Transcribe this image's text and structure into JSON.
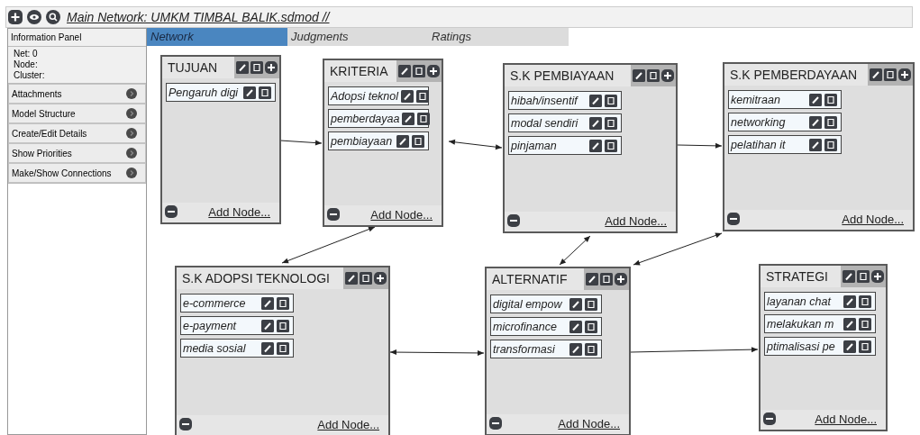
{
  "window": {
    "title": "Main Network: UMKM TIMBAL BALIK.sdmod //"
  },
  "tabs": [
    {
      "label": "Network",
      "selected": true
    },
    {
      "label": "Judgments",
      "selected": false
    },
    {
      "label": "Ratings",
      "selected": false
    }
  ],
  "info_panel": {
    "title": "Information Panel",
    "lines": [
      "Net: 0",
      "Node:",
      "Cluster:"
    ],
    "sections": [
      "Attachments",
      "Model Structure",
      "Create/Edit Details",
      "Show Priorities",
      "Make/Show Connections"
    ]
  },
  "clusters": [
    {
      "title": "TUJUAN",
      "nodes": [
        "Pengaruh digi"
      ],
      "add_label": "Add Node..."
    },
    {
      "title": "KRITERIA",
      "nodes": [
        "Adopsi teknol",
        "pemberdayaa",
        "pembiayaan"
      ],
      "add_label": "Add Node..."
    },
    {
      "title": "S.K PEMBIAYAAN",
      "nodes": [
        "hibah/insentif",
        "modal sendiri",
        "pinjaman"
      ],
      "add_label": "Add Node..."
    },
    {
      "title": "S.K PEMBERDAYAAN",
      "nodes": [
        "kemitraan",
        "networking",
        "pelatihan it"
      ],
      "add_label": "Add Node..."
    },
    {
      "title": "S.K ADOPSI TEKNOLOGI",
      "nodes": [
        "e-commerce",
        "e-payment",
        "media sosial"
      ],
      "add_label": "Add Node..."
    },
    {
      "title": "ALTERNATIF",
      "nodes": [
        "digital empow",
        "microfinance",
        "transformasi"
      ],
      "add_label": "Add Node..."
    },
    {
      "title": "STRATEGI",
      "nodes": [
        "layanan chat",
        "melakukan m",
        "ptimalisasi pe"
      ],
      "add_label": "Add Node..."
    }
  ]
}
